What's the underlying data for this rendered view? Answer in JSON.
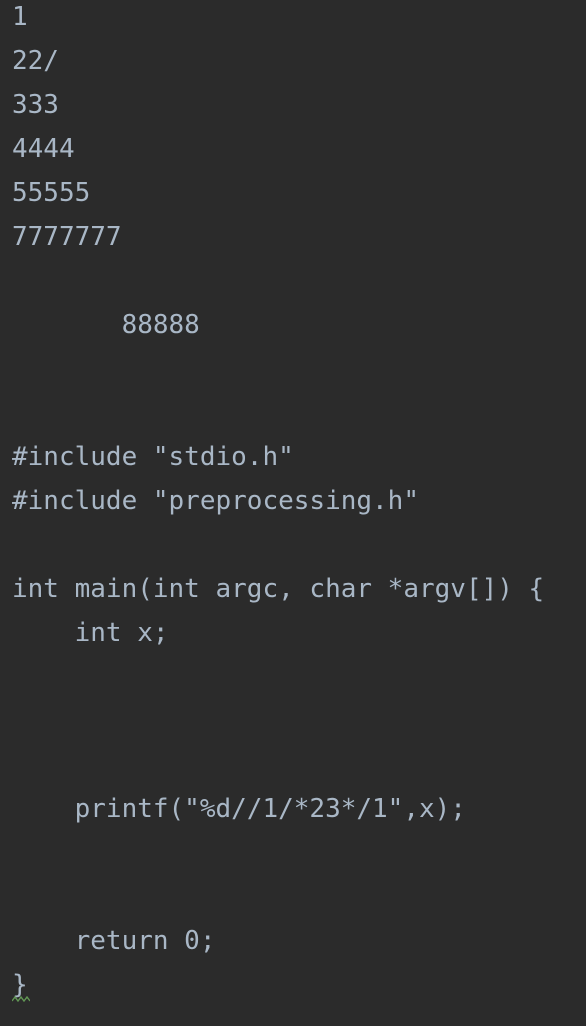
{
  "editor": {
    "lines": [
      "1",
      "22/",
      "333",
      "4444",
      "55555",
      "7777777",
      "",
      "       88888",
      "",
      "",
      "#include \"stdio.h\"",
      "#include \"preprocessing.h\"",
      "",
      "int main(int argc, char *argv[]) {",
      "    int x;",
      "",
      "",
      "",
      "    printf(\"%d//1/*23*/1\",x);",
      "",
      "",
      "    return 0;",
      "}"
    ],
    "text_color": "#a9b7c6",
    "background": "#2b2b2b",
    "warning_color": "#629755"
  }
}
